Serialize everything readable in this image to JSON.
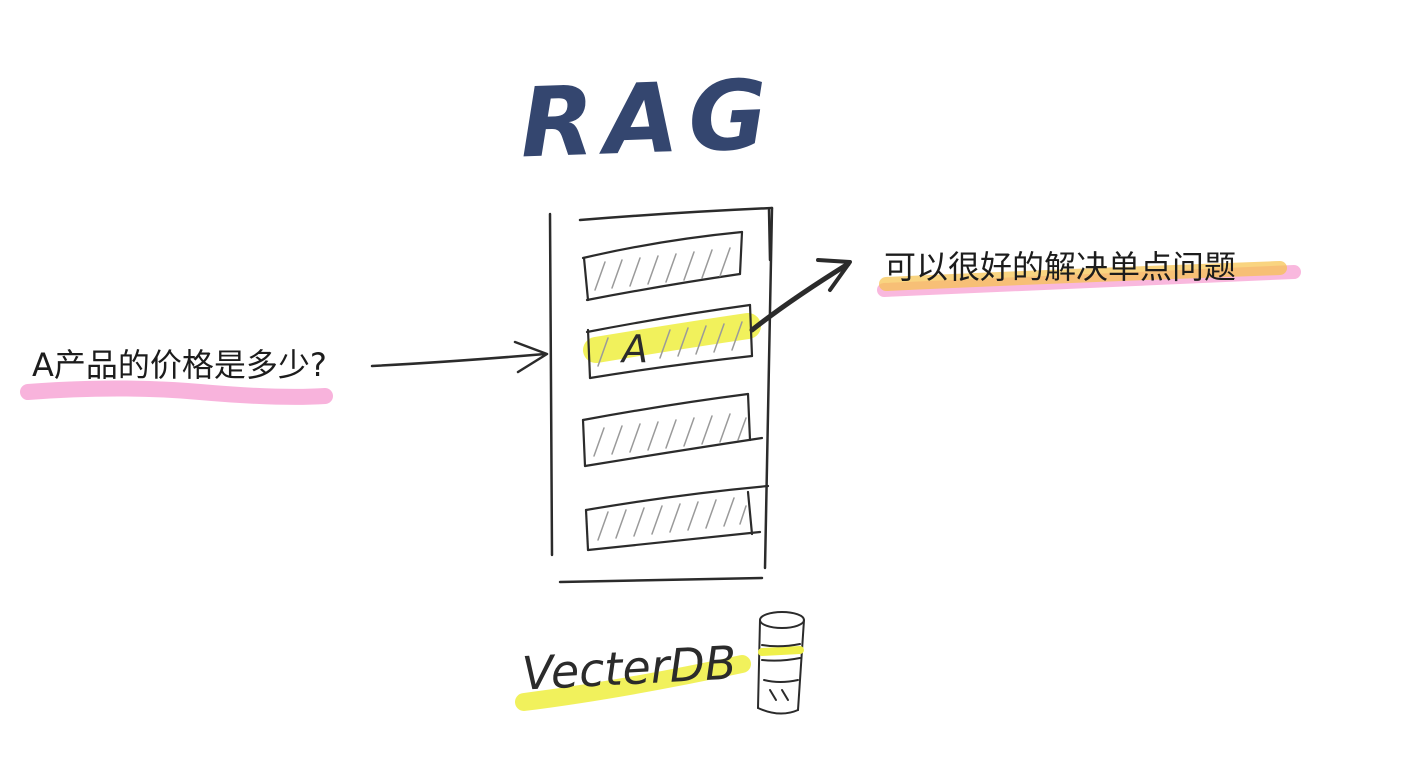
{
  "diagram": {
    "title": "RAG",
    "query_text": "A产品的价格是多少?",
    "answer_text": "可以很好的解决单点问题",
    "chunk_label": "A",
    "db_label": "VecterDB",
    "colors": {
      "ink": "#2b2b2b",
      "title_ink": "#34466f",
      "pink_highlight": "#f7a6d6",
      "yellow_highlight": "#eff04a",
      "orange_highlight": "#f7c24a"
    }
  }
}
